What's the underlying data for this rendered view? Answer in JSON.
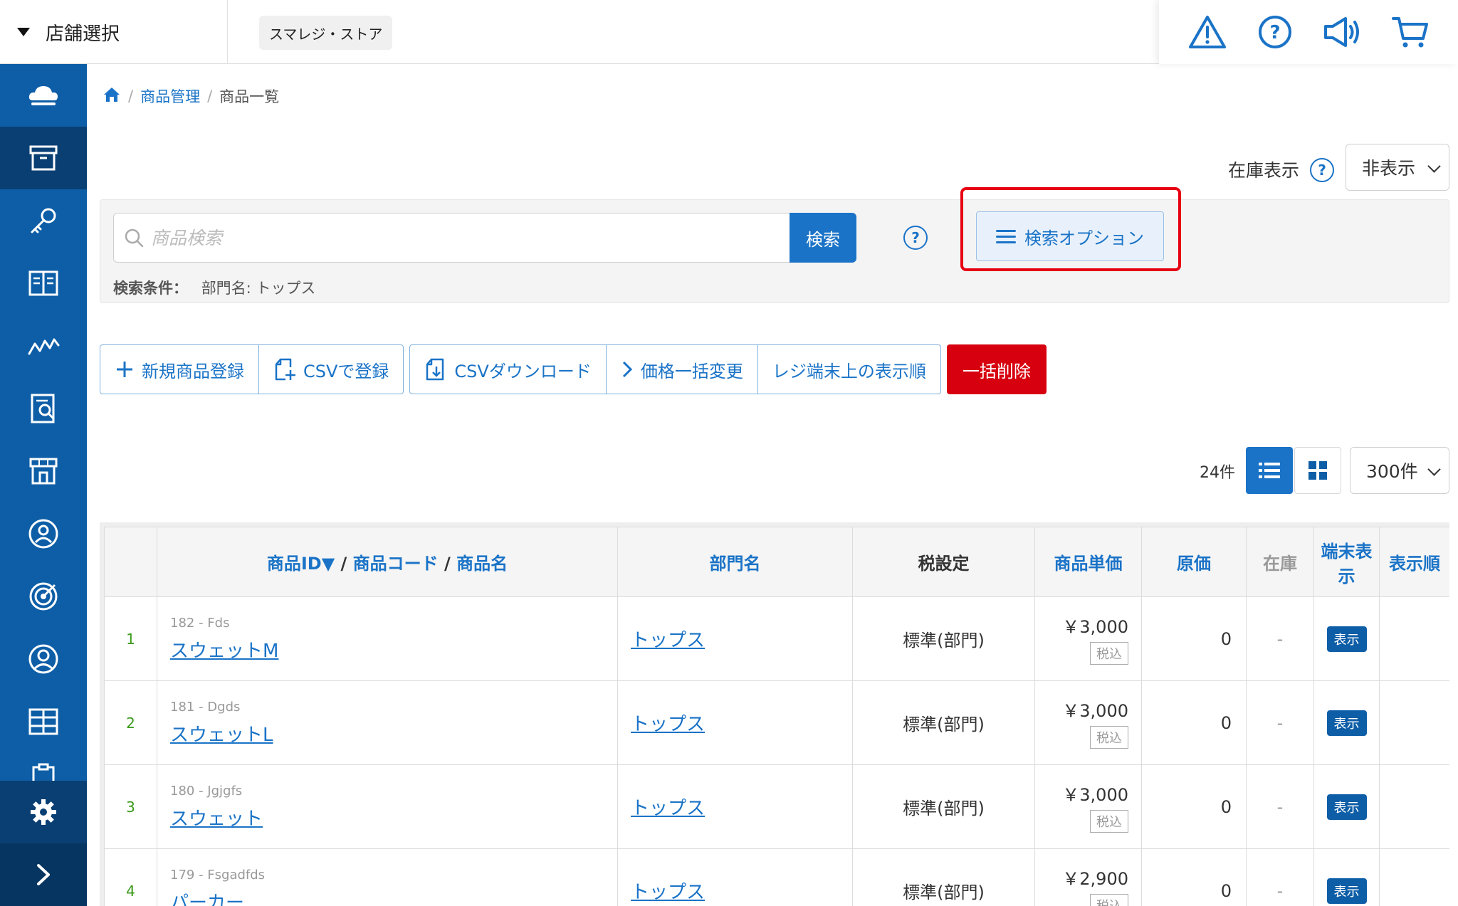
{
  "topbar": {
    "store_select_label": "店舗選択",
    "store_name": "スマレジ・ストア",
    "icons": [
      "warning-icon",
      "help-icon",
      "announcement-icon",
      "cart-icon"
    ]
  },
  "sidebar": {
    "items": [
      "cloud-icon",
      "box-icon",
      "key-icon",
      "book-icon",
      "chart-icon",
      "report-icon",
      "store-icon",
      "member-icon",
      "target-icon",
      "user-icon",
      "grid-icon",
      "clipboard-icon"
    ],
    "active_index": 1,
    "bottom": [
      "gear-icon",
      "chevron-right-icon"
    ]
  },
  "breadcrumb": {
    "home_icon": "home-icon",
    "items": [
      "商品管理",
      "商品一覧"
    ]
  },
  "stock_display": {
    "label": "在庫表示",
    "help": "?",
    "value": "非表示"
  },
  "search": {
    "placeholder": "商品検索",
    "button": "検索",
    "help": "?",
    "condition_label": "検索条件：",
    "condition_value": "部門名: トップス",
    "option_button": "検索オプション"
  },
  "actions": {
    "new_product": "新規商品登録",
    "csv_register": "CSVで登録",
    "csv_download": "CSVダウンロード",
    "bulk_price": "価格一括変更",
    "display_order": "レジ端末上の表示順",
    "bulk_delete": "一括削除"
  },
  "listing": {
    "count": "24件",
    "per_page": "300件"
  },
  "table": {
    "headers": {
      "product_id": "商品ID▼",
      "sep1": "/",
      "product_code": "商品コード",
      "sep2": "/",
      "product_name": "商品名",
      "department": "部門名",
      "tax": "税設定",
      "unit_price": "商品単価",
      "cost": "原価",
      "stock": "在庫",
      "terminal_display": "端末表示",
      "display_order": "表示順"
    },
    "rows": [
      {
        "num": "1",
        "id_code": "182 - Fds",
        "name": "スウェットM",
        "dept": "トップス",
        "tax": "標準(部門)",
        "price": "￥3,000",
        "tax_badge": "税込",
        "cost": "0",
        "stock": "-",
        "display": "表示"
      },
      {
        "num": "2",
        "id_code": "181 - Dgds",
        "name": "スウェットL",
        "dept": "トップス",
        "tax": "標準(部門)",
        "price": "￥3,000",
        "tax_badge": "税込",
        "cost": "0",
        "stock": "-",
        "display": "表示"
      },
      {
        "num": "3",
        "id_code": "180 - Jgjgfs",
        "name": "スウェット",
        "dept": "トップス",
        "tax": "標準(部門)",
        "price": "￥3,000",
        "tax_badge": "税込",
        "cost": "0",
        "stock": "-",
        "display": "表示"
      },
      {
        "num": "4",
        "id_code": "179 - Fsgadfds",
        "name": "パーカー",
        "dept": "トップス",
        "tax": "標準(部門)",
        "price": "￥2,900",
        "tax_badge": "税込",
        "cost": "0",
        "stock": "-",
        "display": "表示"
      }
    ]
  },
  "colors": {
    "primary": "#1a73c7",
    "sidebar": "#0e5ea7",
    "sidebar_active": "#0a3f73",
    "danger": "#d7000f",
    "highlight": "#e60012"
  }
}
